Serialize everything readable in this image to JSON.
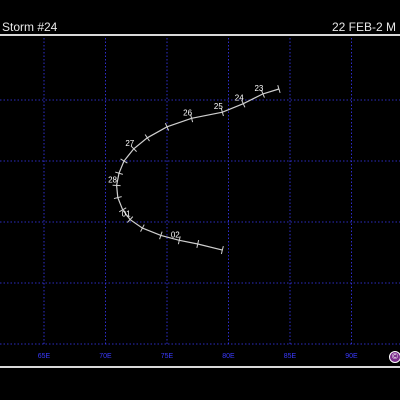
{
  "header": {
    "title": "Storm #24",
    "date_range": "22 FEB-2 M"
  },
  "map": {
    "longitude_labels": [
      "65E",
      "70E",
      "75E",
      "80E",
      "85E",
      "90E"
    ],
    "grid_color": "#3a3aff",
    "track_color": "#cfcfcf",
    "label_color": "#ffffff",
    "track_points": [
      {
        "lon": 84.1,
        "lat": 20.9
      },
      {
        "lon": 82.8,
        "lat": 20.5,
        "label": "23"
      },
      {
        "lon": 81.2,
        "lat": 19.7,
        "label": "24"
      },
      {
        "lon": 79.5,
        "lat": 19.0,
        "label": "25"
      },
      {
        "lon": 77.0,
        "lat": 18.5,
        "label": "26"
      },
      {
        "lon": 75.0,
        "lat": 17.8
      },
      {
        "lon": 73.4,
        "lat": 16.9
      },
      {
        "lon": 72.3,
        "lat": 16.0,
        "label": "27"
      },
      {
        "lon": 71.5,
        "lat": 15.0
      },
      {
        "lon": 71.1,
        "lat": 14.0
      },
      {
        "lon": 70.9,
        "lat": 13.0,
        "label": "28"
      },
      {
        "lon": 71.0,
        "lat": 12.0
      },
      {
        "lon": 71.4,
        "lat": 11.0
      },
      {
        "lon": 72.0,
        "lat": 10.2,
        "label": "01"
      },
      {
        "lon": 73.0,
        "lat": 9.5
      },
      {
        "lon": 74.5,
        "lat": 8.9
      },
      {
        "lon": 76.0,
        "lat": 8.5,
        "label": "02"
      },
      {
        "lon": 77.5,
        "lat": 8.2
      },
      {
        "lon": 79.5,
        "lat": 7.7
      }
    ]
  },
  "logo": {
    "symbol": "©",
    "color": "#7a2c8c"
  }
}
